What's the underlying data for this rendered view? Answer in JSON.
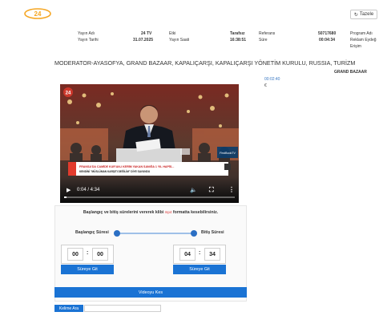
{
  "header": {
    "logo_text": "24",
    "refresh_label": "Tazele"
  },
  "meta": {
    "yayin_adi_label": "Yayın Adı",
    "yayin_adi_value": "24 TV",
    "yayin_tarihi_label": "Yayın Tarihi",
    "yayin_tarihi_value": "31.07.2025",
    "etki_label": "Etki",
    "etki_value": "Tarafsız",
    "yayin_saati_label": "Yayın Saati",
    "yayin_saati_value": "16:38:51",
    "referans_label": "Referans",
    "referans_value": "50717680",
    "sure_label": "Süre",
    "sure_value": "00:04:34",
    "program_adi_label": "Program Adı",
    "reklam_label": "Reklam Eydeğ",
    "erisim_label": "Erişim"
  },
  "page_title": "MODERATOR-AYASOFYA, GRAND BAZAAR, KAPALIÇARŞI, KAPALIÇARŞI YÖNETİM KURULU, RUSSIA, TURİZM",
  "side": {
    "category": "GRAND BAZAAR",
    "timecode": "00:02:40",
    "timecode_sub": "€"
  },
  "video": {
    "channel_badge": "24",
    "news_ticker": "FRANSA'DA CAMİDE KUR'AN-I KERİM YAKAN SANIĞA 1 YIL HAPİS...",
    "news_ticker_sub": "KENDİNİ \"MÜSLÜMAN KARŞITI DEĞİLİM\" DİYE SAVUNDU",
    "time_display": "0:04 / 4:34",
    "progress": 0.015,
    "screen_brand": "FirstBookTV"
  },
  "cut_panel": {
    "instruction_prefix": "Başlangıç ve bitiş sürelerini vererek klibi",
    "format": "mp4",
    "instruction_suffix": "formatta kesebilirsiniz.",
    "start_label": "Başlangıç Süresi",
    "end_label": "Bitiş Süresi",
    "start_min": "00",
    "start_sec": "00",
    "end_min": "04",
    "end_sec": "34",
    "goto_label_start": "Süreye Git",
    "goto_label_end": "Süreye Git",
    "cut_button": "Videoyu Kes"
  },
  "search": {
    "label": "Kelime Ara",
    "value": ""
  },
  "colors": {
    "accent": "#1a73d4",
    "logo": "#f5a623",
    "link": "#3a78c3"
  }
}
